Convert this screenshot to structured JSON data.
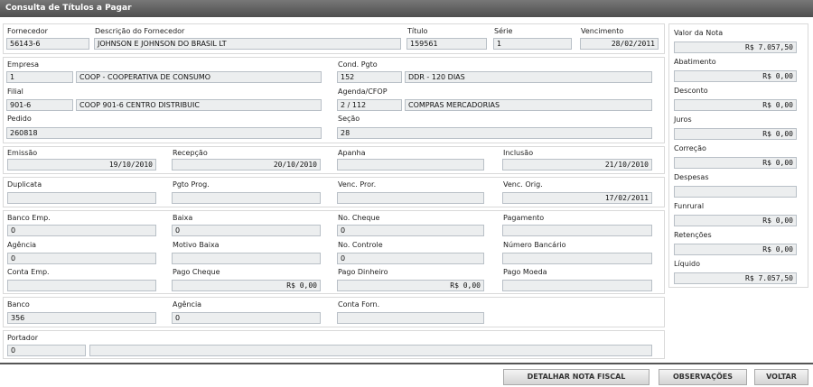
{
  "window": {
    "title": "Consulta de Títulos a Pagar"
  },
  "header": {
    "fornecedor_label": "Fornecedor",
    "fornecedor": "56143-6",
    "descricao_label": "Descrição do Fornecedor",
    "descricao": "JOHNSON E JOHNSON DO BRASIL LT",
    "titulo_label": "Título",
    "titulo": "159561",
    "serie_label": "Série",
    "serie": "1",
    "vencimento_label": "Vencimento",
    "vencimento": "28/02/2011"
  },
  "empresa_section": {
    "empresa_label": "Empresa",
    "empresa_code": "1",
    "empresa_name": "COOP - COOPERATIVA DE CONSUMO",
    "filial_label": "Filial",
    "filial_code": "901-6",
    "filial_name": "COOP 901-6  CENTRO DISTRIBUIC",
    "pedido_label": "Pedido",
    "pedido": "260818",
    "cond_pgto_label": "Cond. Pgto",
    "cond_pgto_code": "152",
    "cond_pgto_desc": "DDR - 120 DIAS",
    "agenda_label": "Agenda/CFOP",
    "agenda_code": "2 / 112",
    "agenda_desc": "COMPRAS MERCADORIAS",
    "secao_label": "Seção",
    "secao": "28"
  },
  "dates": {
    "emissao_label": "Emissão",
    "emissao": "19/10/2010",
    "recepcao_label": "Recepção",
    "recepcao": "20/10/2010",
    "apanha_label": "Apanha",
    "apanha": "",
    "inclusao_label": "Inclusão",
    "inclusao": "21/10/2010"
  },
  "dup": {
    "duplicata_label": "Duplicata",
    "duplicata": "",
    "pgto_prog_label": "Pgto Prog.",
    "pgto_prog": "",
    "venc_pror_label": "Venc. Pror.",
    "venc_pror": "",
    "venc_orig_label": "Venc. Orig.",
    "venc_orig": "17/02/2011"
  },
  "bank": {
    "banco_emp_label": "Banco Emp.",
    "banco_emp": "0",
    "baixa_label": "Baixa",
    "baixa": "0",
    "no_cheque_label": "No. Cheque",
    "no_cheque": "0",
    "pagamento_label": "Pagamento",
    "pagamento": "",
    "agencia_label": "Agência",
    "agencia": "0",
    "motivo_baixa_label": "Motivo Baixa",
    "motivo_baixa": "",
    "no_controle_label": "No. Controle",
    "no_controle": "0",
    "numero_bancario_label": "Número Bancário",
    "numero_bancario": "",
    "conta_emp_label": "Conta Emp.",
    "conta_emp": "",
    "pago_cheque_label": "Pago Cheque",
    "pago_cheque": "R$ 0,00",
    "pago_dinheiro_label": "Pago Dinheiro",
    "pago_dinheiro": "R$ 0,00",
    "pago_moeda_label": "Pago Moeda",
    "pago_moeda": ""
  },
  "forn_bank": {
    "banco_label": "Banco",
    "banco": "356",
    "agencia_label": "Agência",
    "agencia": "0",
    "conta_forn_label": "Conta Forn.",
    "conta_forn": ""
  },
  "portador": {
    "label": "Portador",
    "code": "0",
    "name": ""
  },
  "totals": {
    "valor_nota_label": "Valor da Nota",
    "valor_nota": "R$ 7.057,50",
    "abatimento_label": "Abatimento",
    "abatimento": "R$ 0,00",
    "desconto_label": "Desconto",
    "desconto": "R$ 0,00",
    "juros_label": "Juros",
    "juros": "R$ 0,00",
    "correcao_label": "Correção",
    "correcao": "R$ 0,00",
    "despesas_label": "Despesas",
    "despesas": "",
    "funrural_label": "Funrural",
    "funrural": "R$ 0,00",
    "retencoes_label": "Retenções",
    "retencoes": "R$ 0,00",
    "liquido_label": "Líquido",
    "liquido": "R$ 7.057,50"
  },
  "buttons": {
    "detalhar": "DETALHAR NOTA FISCAL",
    "observacoes": "OBSERVAÇÕES",
    "voltar": "VOLTAR"
  }
}
